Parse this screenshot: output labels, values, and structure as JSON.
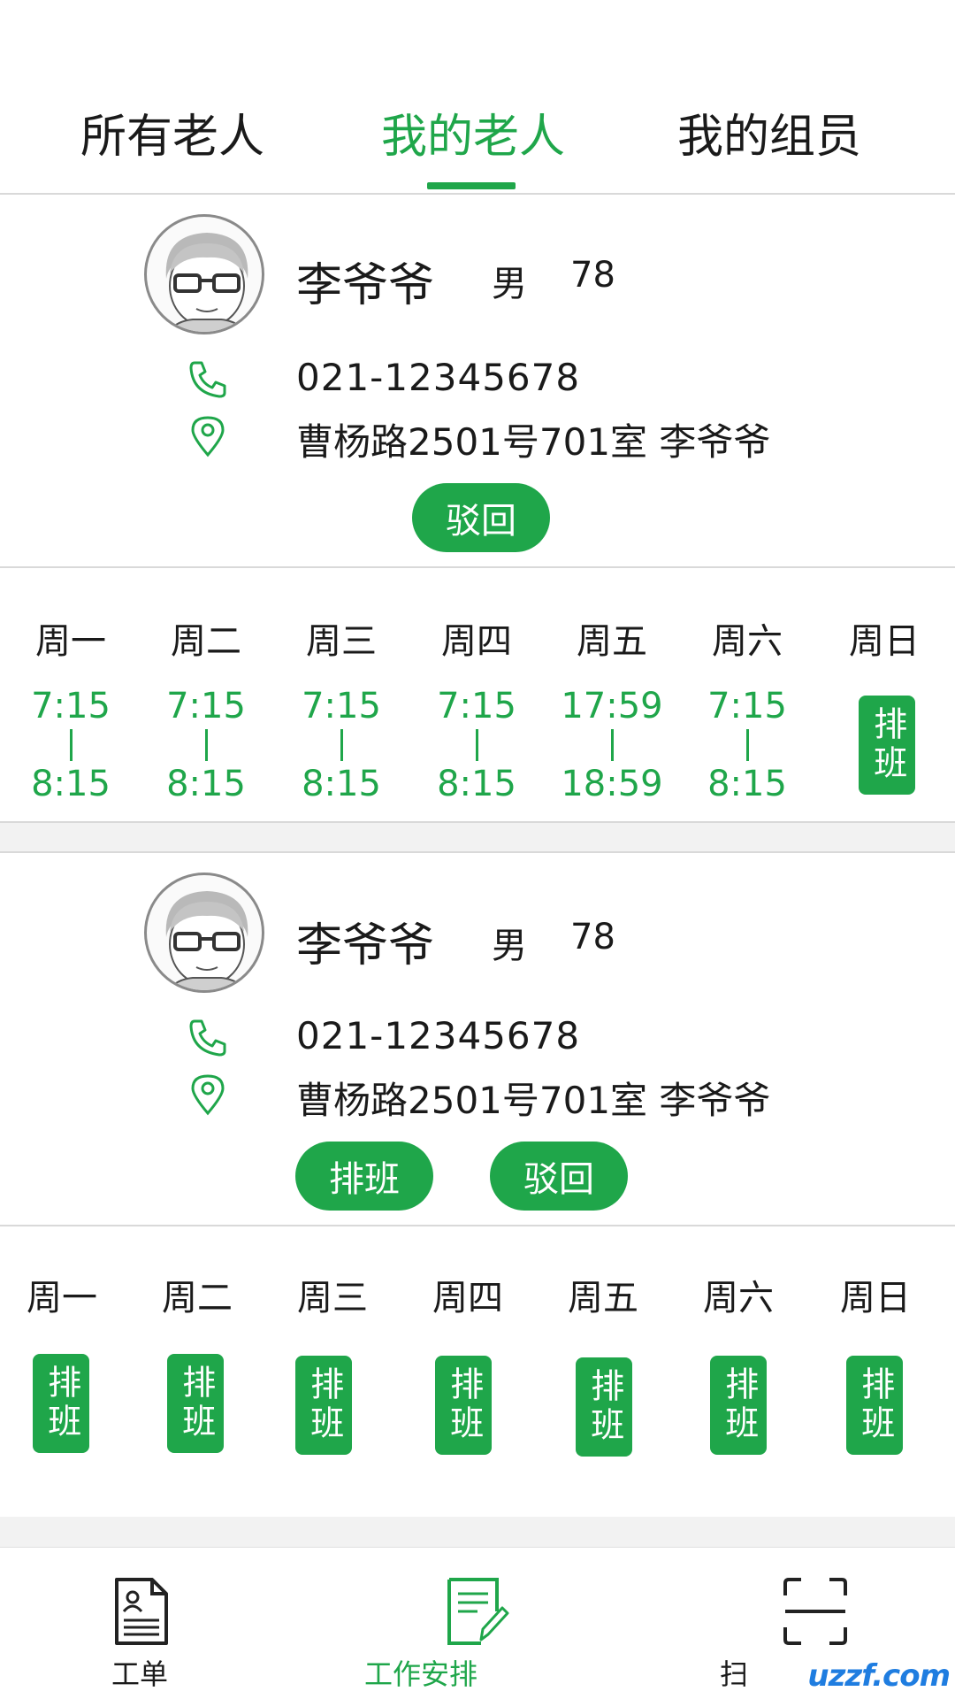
{
  "tabs": [
    {
      "label": "所有老人",
      "active": false
    },
    {
      "label": "我的老人",
      "active": true
    },
    {
      "label": "我的组员",
      "active": false
    }
  ],
  "cards": [
    {
      "name": "李爷爷",
      "gender": "男",
      "age": "78",
      "phone": "021-12345678",
      "address": "曹杨路2501号701室  李爷爷",
      "buttons": [
        "驳回"
      ],
      "days": [
        "周一",
        "周二",
        "周三",
        "周四",
        "周五",
        "周六",
        "周日"
      ],
      "slots": [
        {
          "start": "7:15",
          "end": "8:15"
        },
        {
          "start": "7:15",
          "end": "8:15"
        },
        {
          "start": "7:15",
          "end": "8:15"
        },
        {
          "start": "7:15",
          "end": "8:15"
        },
        {
          "start": "17:59",
          "end": "18:59"
        },
        {
          "start": "7:15",
          "end": "8:15"
        },
        {
          "schedule_label": "排班"
        }
      ]
    },
    {
      "name": "李爷爷",
      "gender": "男",
      "age": "78",
      "phone": "021-12345678",
      "address": "曹杨路2501号701室  李爷爷",
      "buttons": [
        "排班",
        "驳回"
      ],
      "days": [
        "周一",
        "周二",
        "周三",
        "周四",
        "周五",
        "周六",
        "周日"
      ],
      "slots": [
        {
          "schedule_label": "排班"
        },
        {
          "schedule_label": "排班"
        },
        {
          "schedule_label": "排班"
        },
        {
          "schedule_label": "排班"
        },
        {
          "schedule_label": "排班"
        },
        {
          "schedule_label": "排班"
        },
        {
          "schedule_label": "排班"
        }
      ]
    }
  ],
  "bottom_nav": [
    {
      "label": "工单",
      "icon": "document-icon",
      "active": false
    },
    {
      "label": "工作安排",
      "icon": "edit-document-icon",
      "active": true
    },
    {
      "label": "扫",
      "icon": "scan-icon",
      "active": false
    }
  ],
  "watermark": "uzzf.com",
  "colors": {
    "accent": "#1fa64a",
    "divider": "#d9d9d9"
  }
}
